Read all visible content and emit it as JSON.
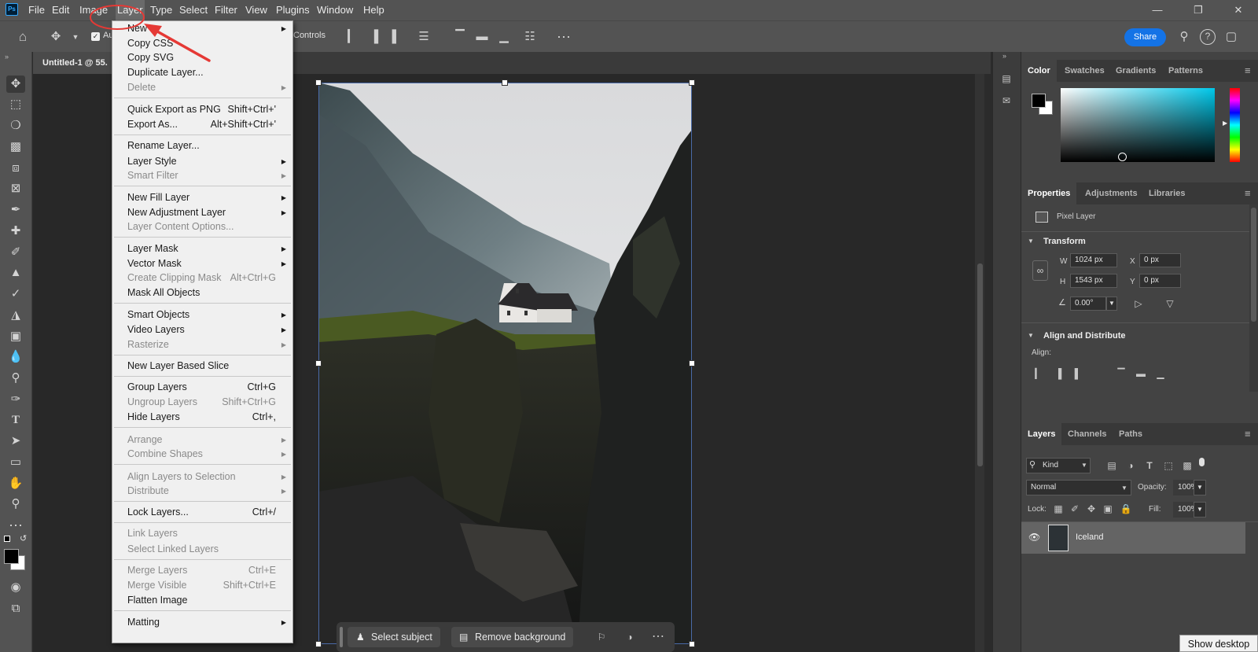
{
  "menubar": {
    "logo": "Ps",
    "items": [
      "File",
      "Edit",
      "Image",
      "Layer",
      "Type",
      "Select",
      "Filter",
      "View",
      "Plugins",
      "Window",
      "Help"
    ]
  },
  "options_bar": {
    "auto_select_label": "Au",
    "transform_controls_label": "Controls",
    "share_label": "Share"
  },
  "document": {
    "tab_title": "Untitled-1 @ 55."
  },
  "layer_menu": {
    "items": [
      {
        "label": "New",
        "arrow": true
      },
      {
        "label": "Copy CSS"
      },
      {
        "label": "Copy SVG"
      },
      {
        "label": "Duplicate Layer..."
      },
      {
        "label": "Delete",
        "arrow": true,
        "disabled": true
      },
      {
        "label": "Quick Export as PNG",
        "shortcut": "Shift+Ctrl+'"
      },
      {
        "label": "Export As...",
        "shortcut": "Alt+Shift+Ctrl+'"
      },
      {
        "label": "Rename Layer..."
      },
      {
        "label": "Layer Style",
        "arrow": true
      },
      {
        "label": "Smart Filter",
        "arrow": true,
        "disabled": true
      },
      {
        "label": "New Fill Layer",
        "arrow": true
      },
      {
        "label": "New Adjustment Layer",
        "arrow": true
      },
      {
        "label": "Layer Content Options...",
        "disabled": true
      },
      {
        "label": "Layer Mask",
        "arrow": true
      },
      {
        "label": "Vector Mask",
        "arrow": true
      },
      {
        "label": "Create Clipping Mask",
        "shortcut": "Alt+Ctrl+G",
        "disabled": true
      },
      {
        "label": "Mask All Objects"
      },
      {
        "label": "Smart Objects",
        "arrow": true
      },
      {
        "label": "Video Layers",
        "arrow": true
      },
      {
        "label": "Rasterize",
        "arrow": true,
        "disabled": true
      },
      {
        "label": "New Layer Based Slice"
      },
      {
        "label": "Group Layers",
        "shortcut": "Ctrl+G"
      },
      {
        "label": "Ungroup Layers",
        "shortcut": "Shift+Ctrl+G",
        "disabled": true
      },
      {
        "label": "Hide Layers",
        "shortcut": "Ctrl+,"
      },
      {
        "label": "Arrange",
        "arrow": true,
        "disabled": true
      },
      {
        "label": "Combine Shapes",
        "arrow": true,
        "disabled": true
      },
      {
        "label": "Align Layers to Selection",
        "arrow": true,
        "disabled": true
      },
      {
        "label": "Distribute",
        "arrow": true,
        "disabled": true
      },
      {
        "label": "Lock Layers...",
        "shortcut": "Ctrl+/"
      },
      {
        "label": "Link Layers",
        "disabled": true
      },
      {
        "label": "Select Linked Layers",
        "disabled": true
      },
      {
        "label": "Merge Layers",
        "shortcut": "Ctrl+E",
        "disabled": true
      },
      {
        "label": "Merge Visible",
        "shortcut": "Shift+Ctrl+E",
        "disabled": true
      },
      {
        "label": "Flatten Image"
      },
      {
        "label": "Matting",
        "arrow": true
      }
    ]
  },
  "color_panel": {
    "tabs": [
      "Color",
      "Swatches",
      "Gradients",
      "Patterns"
    ]
  },
  "properties_panel": {
    "tabs": [
      "Properties",
      "Adjustments",
      "Libraries"
    ],
    "layer_type": "Pixel Layer",
    "transform_title": "Transform",
    "w_label": "W",
    "w_value": "1024 px",
    "h_label": "H",
    "h_value": "1543 px",
    "x_label": "X",
    "x_value": "0 px",
    "y_label": "Y",
    "y_value": "0 px",
    "angle_value": "0.00°",
    "align_title": "Align and Distribute",
    "align_label": "Align:"
  },
  "layers_panel": {
    "tabs": [
      "Layers",
      "Channels",
      "Paths"
    ],
    "filter_kind": "Kind",
    "blend_mode": "Normal",
    "opacity_label": "Opacity:",
    "opacity_value": "100%",
    "lock_label": "Lock:",
    "fill_label": "Fill:",
    "fill_value": "100%",
    "layer_name": "Iceland"
  },
  "context_bar": {
    "select_subject": "Select subject",
    "remove_background": "Remove background"
  },
  "taskbar": {
    "show_desktop": "Show desktop"
  },
  "colors": {
    "accent": "#1473e6",
    "annotation": "#e53935"
  }
}
